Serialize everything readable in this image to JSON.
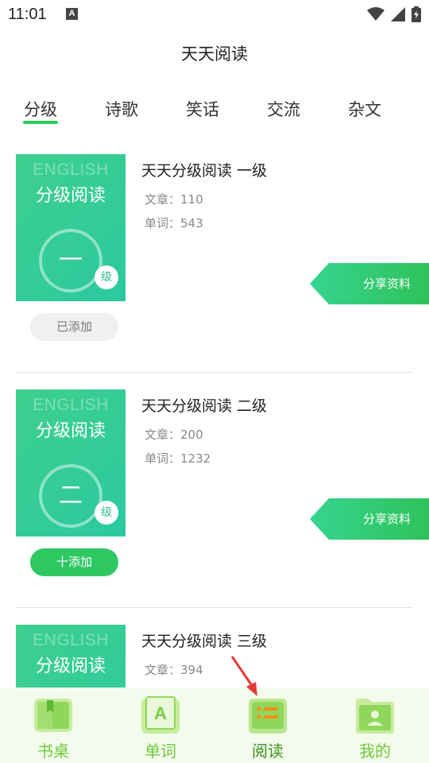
{
  "status": {
    "time": "11:01",
    "a_icon": "A"
  },
  "header": {
    "title": "天天阅读"
  },
  "tabs": [
    {
      "label": "分级",
      "active": true
    },
    {
      "label": "诗歌"
    },
    {
      "label": "笑话"
    },
    {
      "label": "交流"
    },
    {
      "label": "杂文"
    }
  ],
  "books": [
    {
      "cover_en": "ENGLISH",
      "cover_cn": "分级阅读",
      "cover_level": "一",
      "cover_badge": "级",
      "title": "天天分级阅读 一级",
      "articles": "文章：110",
      "words": "单词：543",
      "share_label": "分享资料",
      "add_label": "已添加",
      "added": true
    },
    {
      "cover_en": "ENGLISH",
      "cover_cn": "分级阅读",
      "cover_level": "二",
      "cover_badge": "级",
      "title": "天天分级阅读 二级",
      "articles": "文章：200",
      "words": "单词：1232",
      "share_label": "分享资料",
      "add_label": "十添加",
      "added": false
    },
    {
      "cover_en": "ENGLISH",
      "cover_cn": "分级阅读",
      "title": "天天分级阅读 三级",
      "articles": "文章：394"
    }
  ],
  "nav": [
    {
      "label": "书桌",
      "icon": "book-icon"
    },
    {
      "label": "单词",
      "icon": "word-card-icon"
    },
    {
      "label": "阅读",
      "icon": "reading-list-icon",
      "active": true
    },
    {
      "label": "我的",
      "icon": "profile-folder-icon"
    }
  ],
  "colors": {
    "accent": "#2ecb5a",
    "cover": "#33cc96",
    "nav_background": "#f3fcec",
    "nav_label": "#6ec93a",
    "reading_icon": "#ff8c1a",
    "arrow": "#e53935"
  }
}
